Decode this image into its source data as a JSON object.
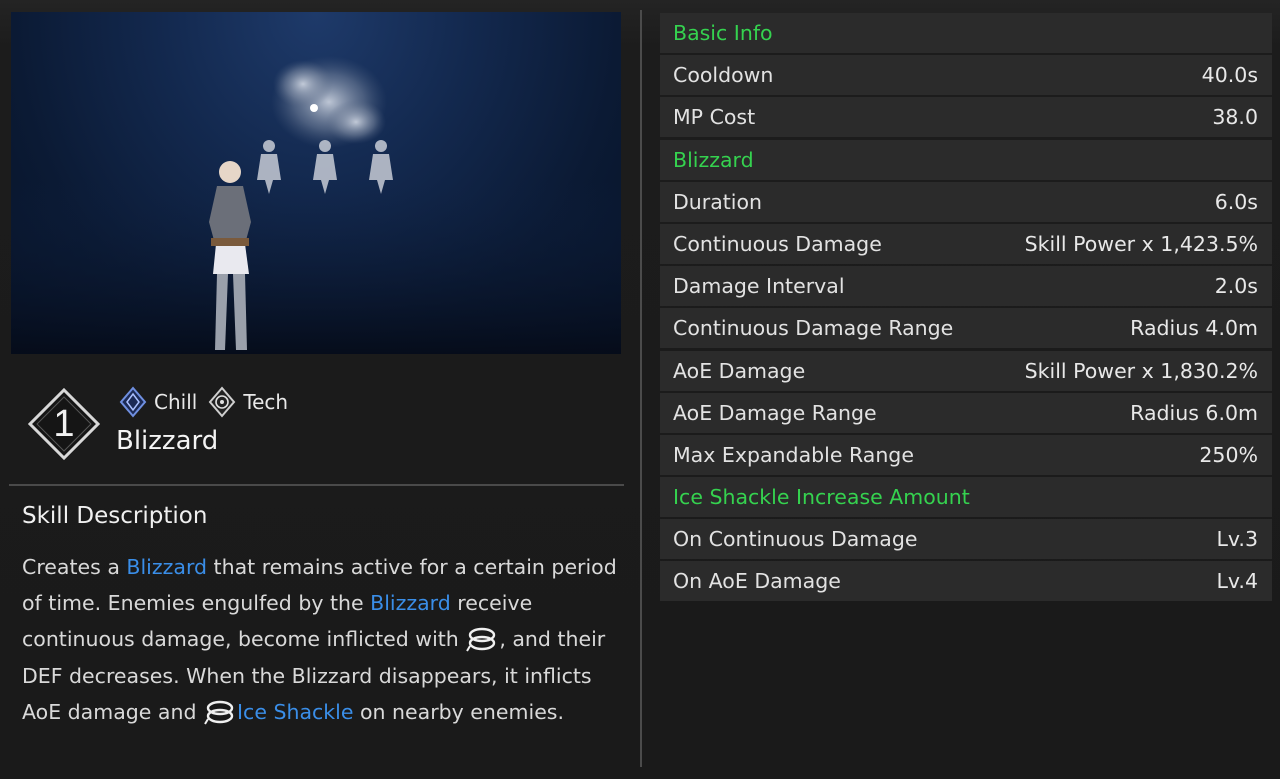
{
  "skill": {
    "number": "1",
    "tags": [
      {
        "label": "Chill",
        "icon": "chill-element-icon"
      },
      {
        "label": "Tech",
        "icon": "tech-attribute-icon"
      }
    ],
    "name": "Blizzard"
  },
  "description": {
    "title": "Skill Description",
    "parts": {
      "p1": "Creates a ",
      "hl1": "Blizzard",
      "p2": " that remains active for a certain period of time. Enemies engulfed by the ",
      "hl2": "Blizzard",
      "p3": " receive continuous damage, become inflicted with ",
      "p4": ", and their DEF decreases. When the Blizzard disappears, it inflicts AoE damage and ",
      "hl3": "Ice Shackle",
      "p5": " on nearby enemies."
    }
  },
  "stats": [
    {
      "type": "section",
      "label": "Basic Info"
    },
    {
      "type": "row",
      "label": "Cooldown",
      "value": "40.0s"
    },
    {
      "type": "row",
      "label": "MP Cost",
      "value": "38.0"
    },
    {
      "type": "section",
      "label": "Blizzard"
    },
    {
      "type": "row",
      "label": "Duration",
      "value": "6.0s"
    },
    {
      "type": "row",
      "label": "Continuous Damage",
      "value": "Skill Power x 1,423.5%"
    },
    {
      "type": "row",
      "label": "Damage Interval",
      "value": "2.0s"
    },
    {
      "type": "row",
      "label": "Continuous Damage Range",
      "value": "Radius 4.0m"
    },
    {
      "type": "row",
      "label": "AoE Damage",
      "value": "Skill Power x 1,830.2%"
    },
    {
      "type": "row",
      "label": "AoE Damage Range",
      "value": "Radius 6.0m"
    },
    {
      "type": "row",
      "label": "Max Expandable Range",
      "value": "250%"
    },
    {
      "type": "section",
      "label": "Ice Shackle Increase Amount"
    },
    {
      "type": "row",
      "label": "On Continuous Damage",
      "value": "Lv.3"
    },
    {
      "type": "row",
      "label": "On AoE Damage",
      "value": "Lv.4"
    }
  ],
  "colors": {
    "section_header": "#35d24f",
    "highlight": "#3a8ee8",
    "row_bg": "#2b2b2b"
  }
}
